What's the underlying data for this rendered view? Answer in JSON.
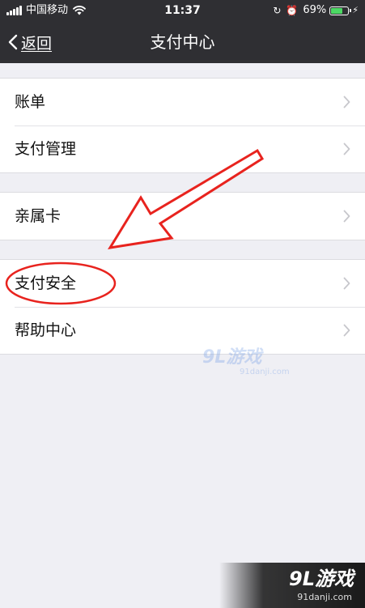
{
  "status_bar": {
    "carrier": "中国移动",
    "time": "11:37",
    "battery_percent": "69%",
    "battery_level": 0.69,
    "battery_color": "#4cd964"
  },
  "nav": {
    "back_label": "返回",
    "title": "支付中心"
  },
  "groups": [
    {
      "items": [
        {
          "label": "账单"
        },
        {
          "label": "支付管理"
        }
      ]
    },
    {
      "items": [
        {
          "label": "亲属卡"
        }
      ]
    },
    {
      "items": [
        {
          "label": "支付安全"
        },
        {
          "label": "帮助中心"
        }
      ]
    }
  ],
  "annotation_color": "#e8231e",
  "watermark": {
    "logo": "9L游戏",
    "url": "91danji.com"
  }
}
